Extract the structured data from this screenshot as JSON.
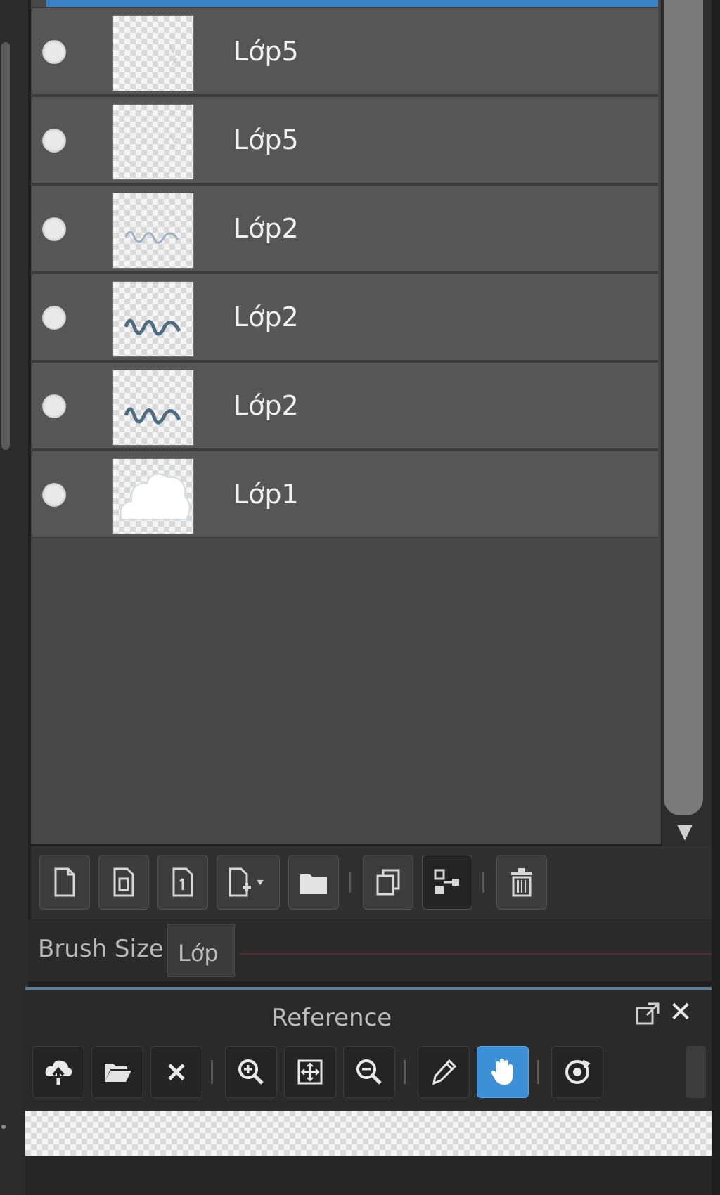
{
  "layers": [
    {
      "name": "Lớp5",
      "thumbnail": "faint-sketch-icon"
    },
    {
      "name": "Lớp5",
      "thumbnail": "faint-sketch-icon"
    },
    {
      "name": "Lớp2",
      "thumbnail": "light-brush-text-icon"
    },
    {
      "name": "Lớp2",
      "thumbnail": "brush-text-icon"
    },
    {
      "name": "Lớp2",
      "thumbnail": "brush-text-icon"
    },
    {
      "name": "Lớp1",
      "thumbnail": "cloud-icon"
    }
  ],
  "layer_toolbar": {
    "icons": [
      "new-layer-icon",
      "new-raster-layer-icon",
      "new-vector-layer-icon",
      "add-layer-dropdown-icon",
      "new-folder-icon",
      "duplicate-layer-icon",
      "merge-layer-icon",
      "delete-layer-icon"
    ]
  },
  "brush": {
    "label": "Brush Size",
    "tab_label": "Lớp"
  },
  "reference": {
    "title": "Reference",
    "close_label": "✕",
    "icons": [
      "upload-icon",
      "open-folder-icon",
      "close-icon",
      "zoom-in-icon",
      "fit-icon",
      "zoom-out-icon",
      "eyedropper-icon",
      "hand-icon",
      "rotate-icon"
    ]
  },
  "colors": {
    "accent": "#3b82c4",
    "panel_bg": "#474747",
    "row_bg": "#565656",
    "active_tool": "#3d8fd6"
  }
}
